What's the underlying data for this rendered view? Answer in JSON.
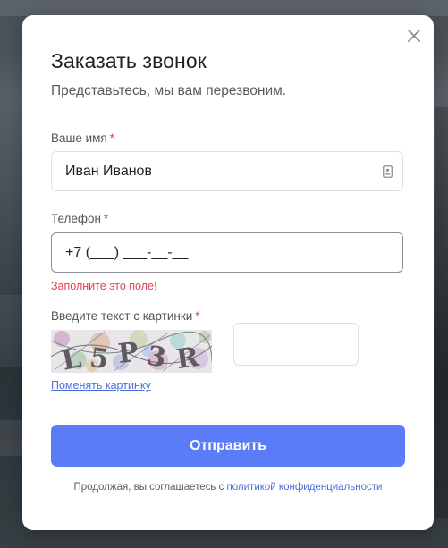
{
  "modal": {
    "title": "Заказать звонок",
    "subtitle": "Представьтесь, мы вам перезвоним.",
    "close_icon": "close-icon"
  },
  "form": {
    "name_label": "Ваше имя",
    "name_value": "Иван Иванов",
    "name_field_icon": "contact-card-icon",
    "phone_label": "Телефон",
    "phone_value": "+7 (___) ___-__-__",
    "phone_error": "Заполните это поле!",
    "captcha_label": "Введите текст с картинки",
    "captcha_text": "L5P3R",
    "captcha_input_value": "",
    "captcha_refresh_link": "Поменять картинку",
    "required_mark": "*",
    "submit_label": "Отправить"
  },
  "consent": {
    "text": "Продолжая, вы соглашаетесь с",
    "link_text": "политикой конфиденциальности"
  },
  "colors": {
    "accent": "#5b7cf8",
    "error": "#e0424f",
    "link": "#4a6fd8"
  }
}
